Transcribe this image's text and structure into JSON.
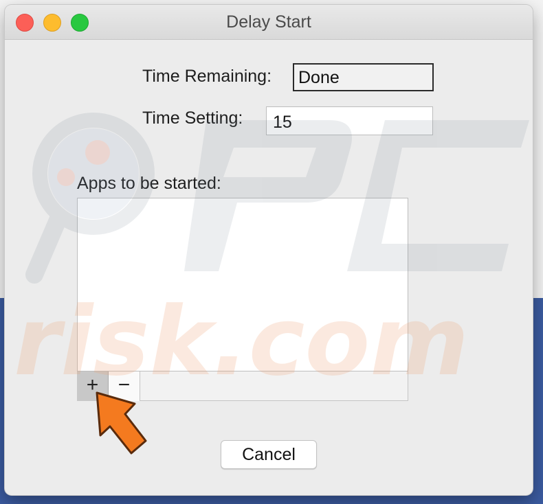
{
  "window": {
    "title": "Delay Start"
  },
  "form": {
    "time_remaining_label": "Time Remaining:",
    "time_remaining_value": "Done",
    "time_setting_label": "Time Setting:",
    "time_setting_value": "15",
    "apps_label": "Apps to be started:"
  },
  "list_toolbar": {
    "add_glyph": "+",
    "remove_glyph": "−"
  },
  "buttons": {
    "cancel_label": "Cancel"
  },
  "watermark": {
    "brand_text": "risk.com"
  },
  "colors": {
    "close": "#fc5f57",
    "minimize": "#fdbc2e",
    "zoom": "#28c840",
    "arrow": "#f47a1f",
    "desktop": "#3b5ba0"
  },
  "icons": [
    "close-icon",
    "minimize-icon",
    "zoom-icon",
    "plus-icon",
    "minus-icon",
    "pointer-arrow-icon",
    "pcrisk-logo"
  ]
}
